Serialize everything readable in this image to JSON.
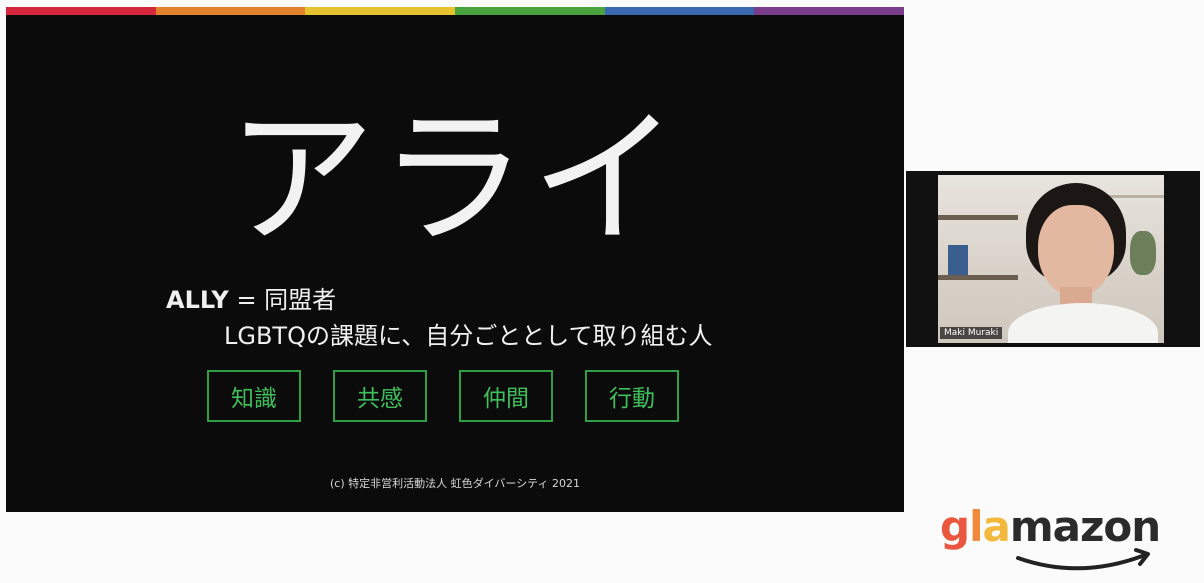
{
  "slide": {
    "rainbow_colors": [
      "#d6263b",
      "#e2822d",
      "#e6c22f",
      "#49a33e",
      "#3a68b1",
      "#7a3d8c"
    ],
    "title": "アライ",
    "ally_label": "ALLY",
    "ally_eq": " = 同盟者",
    "definition": "LGBTQの課題に、自分ごととして取り組む人",
    "keywords": [
      "知識",
      "共感",
      "仲間",
      "行動"
    ],
    "copyright": "(c) 特定非営利活動法人 虹色ダイバーシティ 2021",
    "accent_color": "#2ea043"
  },
  "video": {
    "participant_name": "Maki Muraki"
  },
  "logo": {
    "text": "glamazon",
    "letter_colors": [
      "#e9573f",
      "#f08a3a",
      "#f4b93c",
      "#8cc152",
      "#3bafda",
      "#4a89dc",
      "#967adc",
      "#d770ad"
    ]
  }
}
